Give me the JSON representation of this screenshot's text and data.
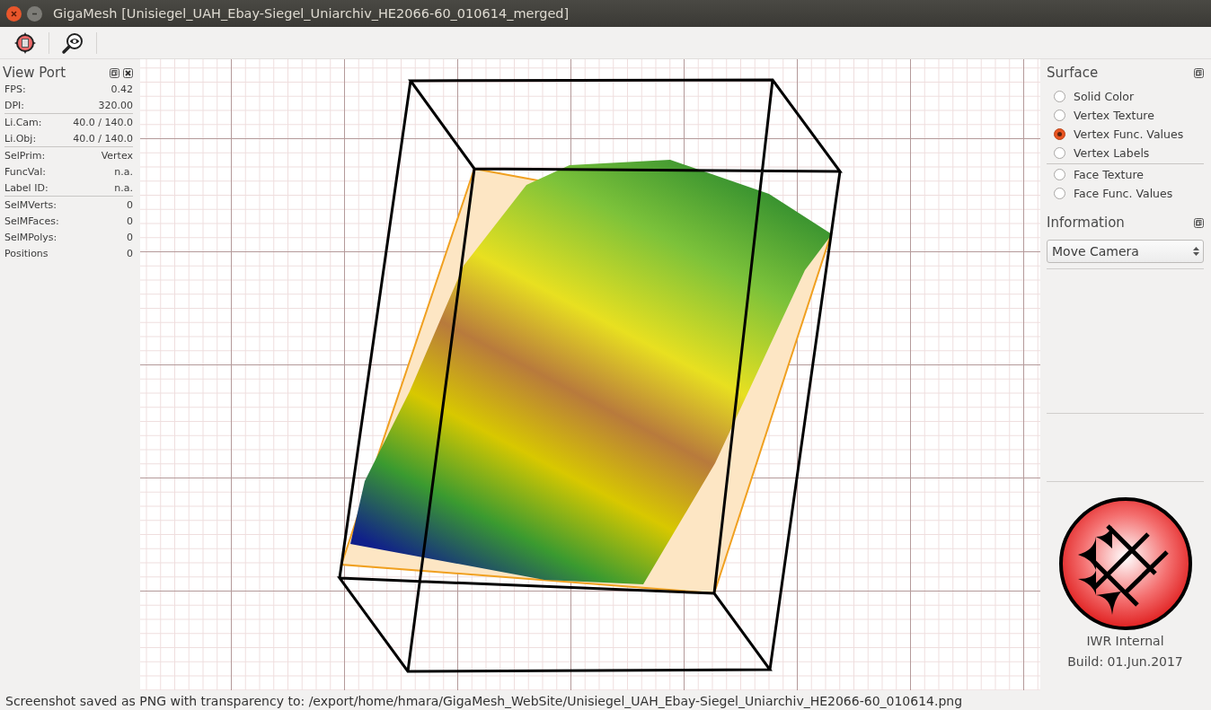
{
  "window": {
    "title": "GigaMesh [Unisiegel_UAH_Ebay-Siegel_Uniarchiv_HE2066-60_010614_merged]"
  },
  "view_port": {
    "title": "View Port",
    "groups": [
      [
        {
          "label": "FPS:",
          "value": "0.42"
        },
        {
          "label": "DPI:",
          "value": "320.00"
        }
      ],
      [
        {
          "label": "Li.Cam:",
          "value": "40.0 / 140.0"
        },
        {
          "label": "Li.Obj:",
          "value": "40.0 / 140.0"
        }
      ],
      [
        {
          "label": "SelPrim:",
          "value": "Vertex"
        },
        {
          "label": "FuncVal:",
          "value": "n.a."
        },
        {
          "label": "Label ID:",
          "value": "n.a."
        }
      ],
      [
        {
          "label": "SelMVerts:",
          "value": "0"
        },
        {
          "label": "SelMFaces:",
          "value": "0"
        },
        {
          "label": "SelMPolys:",
          "value": "0"
        },
        {
          "label": "Positions",
          "value": "0"
        }
      ]
    ]
  },
  "surface": {
    "title": "Surface",
    "groups": [
      [
        {
          "label": "Solid Color",
          "selected": false
        },
        {
          "label": "Vertex Texture",
          "selected": false
        },
        {
          "label": "Vertex Func. Values",
          "selected": true
        },
        {
          "label": "Vertex Labels",
          "selected": false
        }
      ],
      [
        {
          "label": "Face Texture",
          "selected": false
        },
        {
          "label": "Face Func. Values",
          "selected": false
        }
      ]
    ]
  },
  "information": {
    "title": "Information",
    "dropdown": {
      "value": "Move Camera"
    }
  },
  "logo": {
    "caption": [
      "IWR Internal",
      "Build: 01.Jun.2017"
    ]
  },
  "status_bar": "Screenshot saved as PNG with transparency to: /export/home/hmara/GigaMesh_WebSite/Unisiegel_UAH_Ebay-Siegel_Uniarchiv_HE2066-60_010614.png"
}
